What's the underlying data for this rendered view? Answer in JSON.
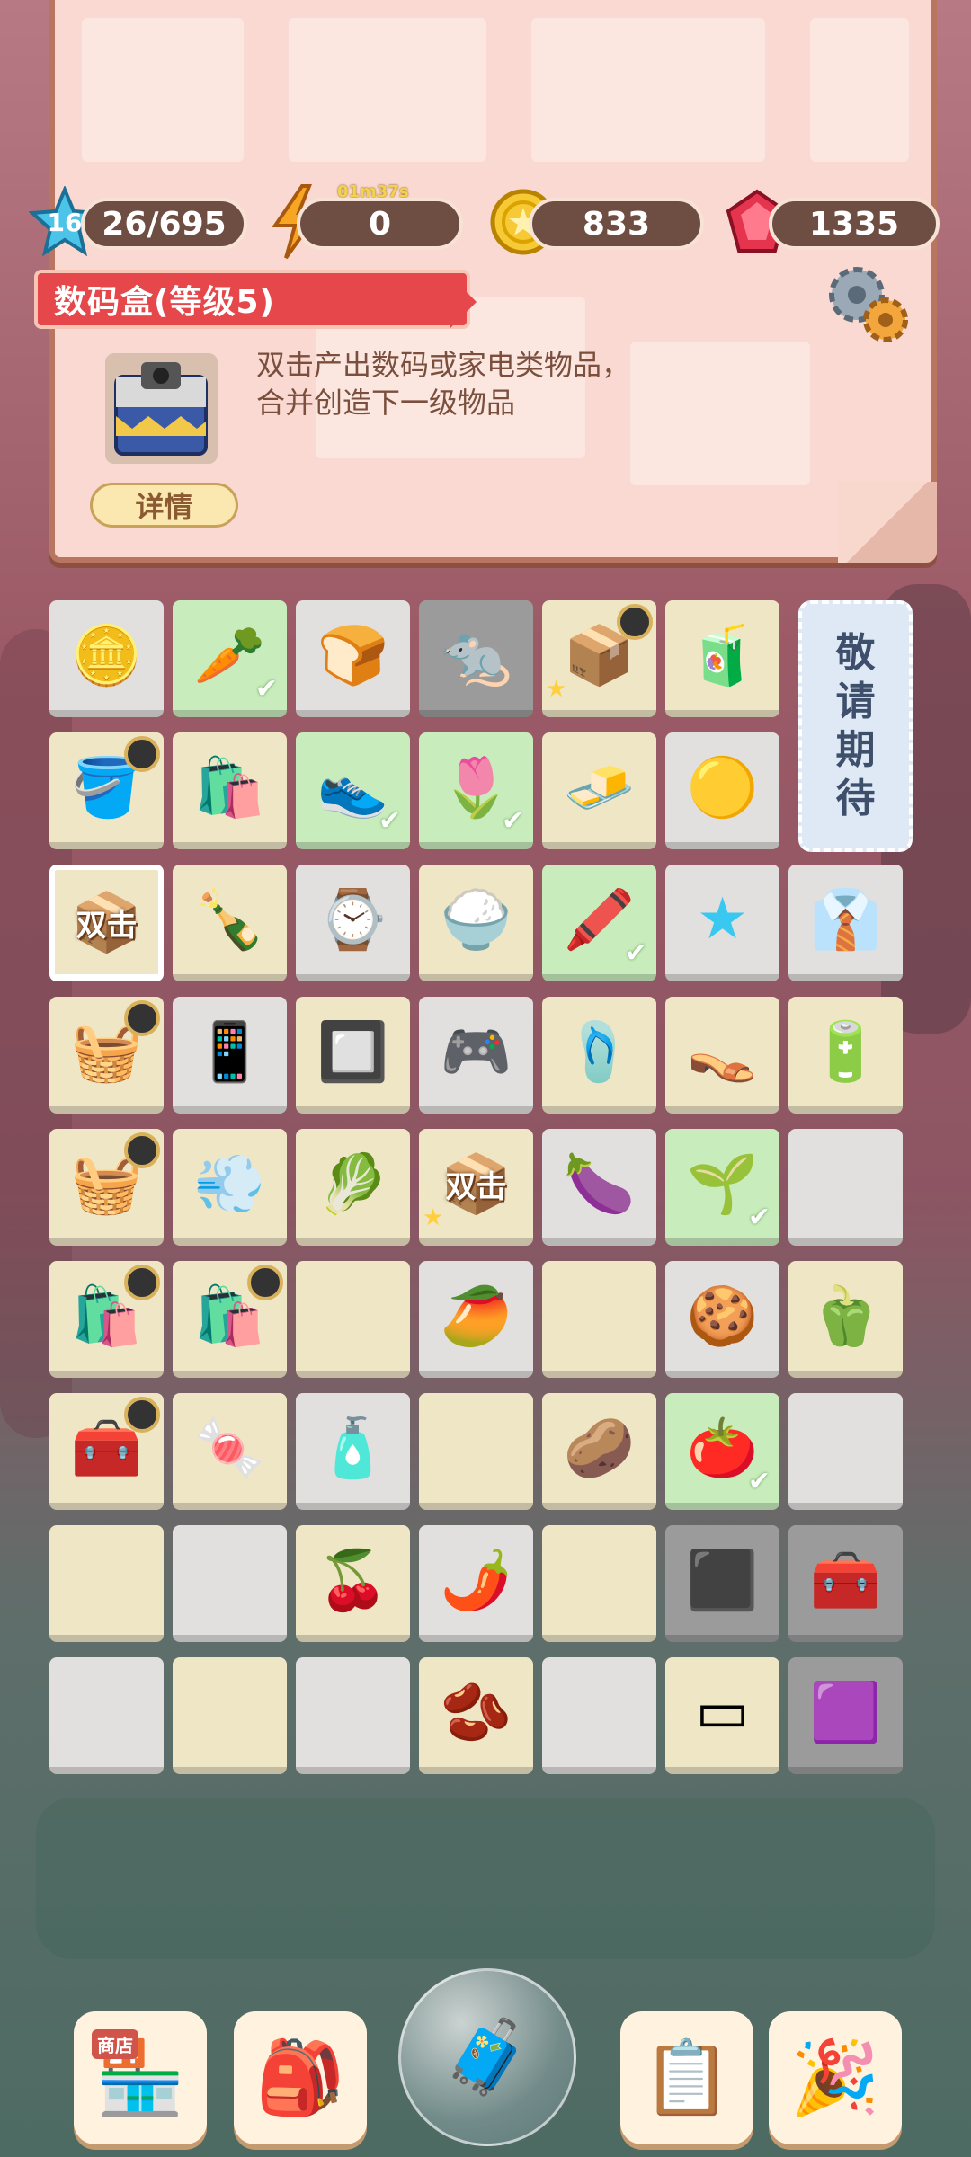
{
  "stats": {
    "level": "16",
    "xp": "26/695",
    "energy": "0",
    "energy_timer": "01m37s",
    "coins": "833",
    "gems": "1335"
  },
  "selected_item": {
    "title": "数码盒(等级5)",
    "description": "双击产出数码或家电类物品，合并创造下一级物品",
    "detail_button": "详情"
  },
  "coming_soon": [
    "敬",
    "请",
    "期",
    "待"
  ],
  "double_label": "双击",
  "grid": [
    [
      "coins",
      "carrot",
      "biscuit",
      "rat",
      "digital-box-gold",
      "juice-carton"
    ],
    [
      "flower-pot",
      "chips-bag",
      "sneakers",
      "white-flower",
      "gold-bars",
      "robot-vacuum"
    ],
    [
      "digital-box-selected",
      "soda-bottle",
      "smart-band",
      "rice-cooker",
      "pen-box",
      "blue-star",
      "necktie"
    ],
    [
      "fruit-basket",
      "smartphone",
      "induction-cooker",
      "game-console",
      "sandals",
      "leather-sandals",
      "battery"
    ],
    [
      "vegetable-basket",
      "hair-dryer",
      "cabbage",
      "double-box-gold",
      "eggplant",
      "soil-plant",
      ""
    ],
    [
      "shopping-bags",
      "shopping-bag-red",
      "",
      "",
      "mango",
      "",
      "cookie-box",
      "green-pepper"
    ],
    [
      "tool-basket",
      "candy",
      "water-bottle",
      "",
      "potato",
      "tomato",
      ""
    ],
    [
      "",
      "",
      "cherries",
      "chili",
      "",
      "slate-locked",
      "toolbox-locked"
    ],
    [
      "",
      "",
      "",
      "coffee-bean",
      "",
      "slate",
      "purple-cushion-locked"
    ]
  ],
  "nav": {
    "shop_label": "商店",
    "buttons": [
      "shop-icon",
      "backpack-icon",
      "treasure-bubble-icon",
      "task-clipboard-icon",
      "party-popper-icon"
    ]
  }
}
